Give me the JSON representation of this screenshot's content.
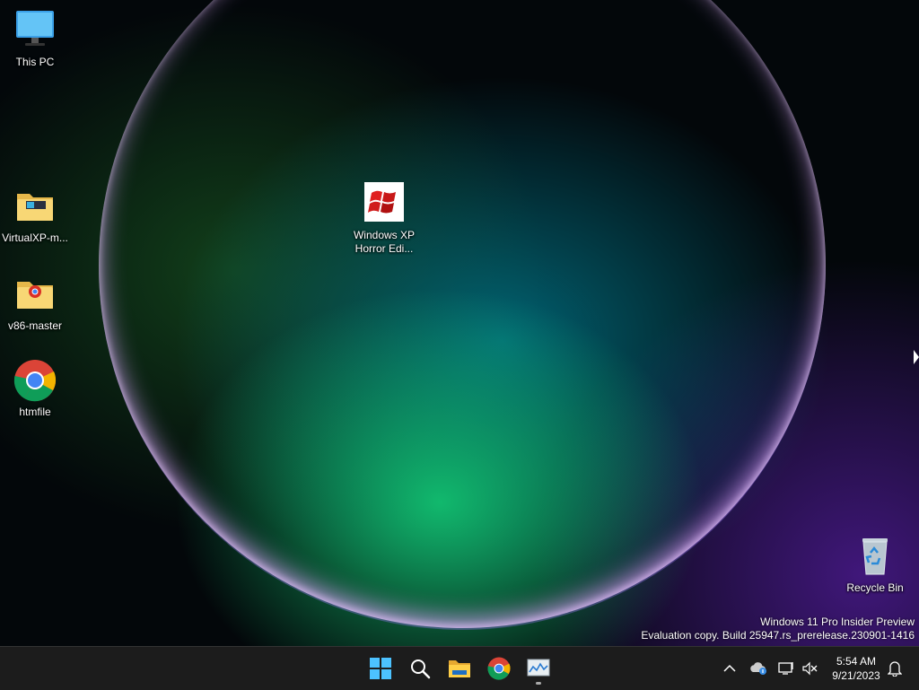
{
  "desktop": {
    "icons": [
      {
        "label": "This PC"
      },
      {
        "label": "VirtualXP-m..."
      },
      {
        "label": "v86-master"
      },
      {
        "label": "htmfile"
      },
      {
        "label_line1": "Windows XP",
        "label_line2": "Horror Edi..."
      },
      {
        "label": "Recycle Bin"
      }
    ],
    "watermark": {
      "line1": "Windows 11 Pro Insider Preview",
      "line2": "Evaluation copy. Build 25947.rs_prerelease.230901-1416"
    }
  },
  "taskbar": {
    "apps": [
      "start-icon",
      "search-icon",
      "file-explorer-icon",
      "chrome-icon",
      "task-manager-icon"
    ],
    "tray_icons": [
      "chevron-up-icon",
      "onedrive-icon",
      "network-icon",
      "volume-muted-icon",
      "notification-bell-icon"
    ],
    "clock": {
      "time": "5:54 AM",
      "date": "9/21/2023"
    }
  }
}
